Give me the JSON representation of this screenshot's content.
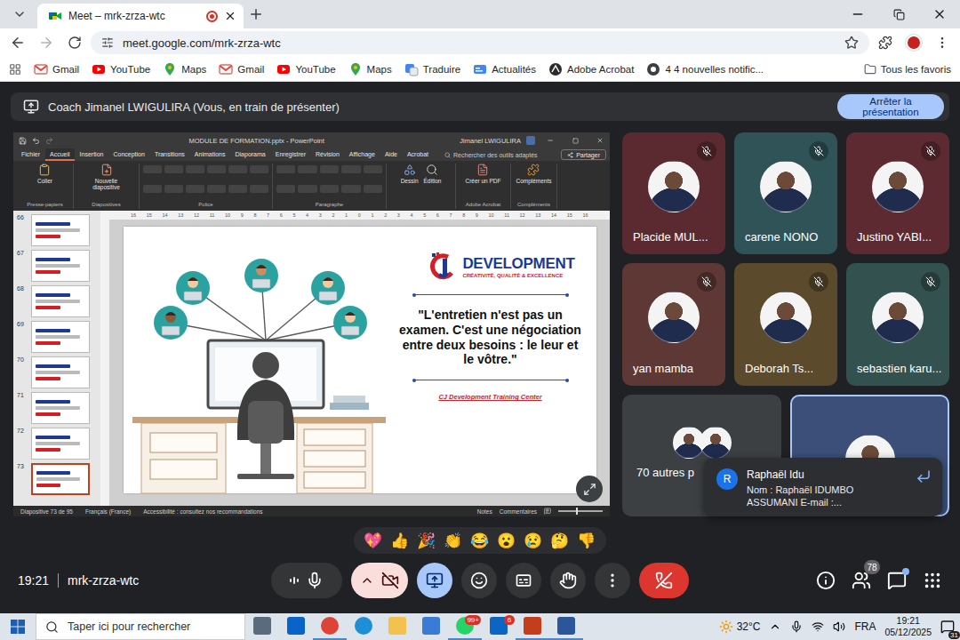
{
  "browser": {
    "tab": {
      "title": "Meet – mrk-zrza-wtc",
      "recording": true
    },
    "url": "meet.google.com/mrk-zrza-wtc",
    "bookmarked": false,
    "bookmarks": [
      {
        "label": "Gmail",
        "kind": "gmail"
      },
      {
        "label": "YouTube",
        "kind": "youtube"
      },
      {
        "label": "Maps",
        "kind": "maps"
      },
      {
        "label": "Gmail",
        "kind": "gmail"
      },
      {
        "label": "YouTube",
        "kind": "youtube"
      },
      {
        "label": "Maps",
        "kind": "maps"
      },
      {
        "label": "Traduire",
        "kind": "translate"
      },
      {
        "label": "Actualités",
        "kind": "news"
      },
      {
        "label": "Adobe Acrobat",
        "kind": "acrobat"
      },
      {
        "label": "4 4 nouvelles notific...",
        "kind": "notif"
      }
    ],
    "all_bookmarks": "Tous les favoris"
  },
  "meet": {
    "presenting_banner": "Coach Jimanel LWIGULIRA (Vous, en train de présenter)",
    "stop_button": "Arrêter la présentation",
    "participants": [
      {
        "name": "Placide MUL...",
        "muted": true,
        "color": "#5a2a30"
      },
      {
        "name": "carene NONO",
        "muted": true,
        "color": "#2f5357"
      },
      {
        "name": "Justino YABI...",
        "muted": true,
        "color": "#5e2a31"
      },
      {
        "name": "yan mamba",
        "muted": true,
        "color": "#5e3835"
      },
      {
        "name": "Deborah Ts...",
        "muted": true,
        "color": "#5b4a2b"
      },
      {
        "name": "sebastien karu...",
        "muted": true,
        "color": "#33524f"
      }
    ],
    "others": {
      "label": "70 autres p",
      "color": "#3c4043"
    },
    "self": {
      "color": "#3b4f78",
      "highlighted": true
    },
    "notification": {
      "avatar": "R",
      "name": "Raphaël Idu",
      "message": "Nom : Raphaël IDUMBO ASSUMANI E-mail :..."
    },
    "reactions": [
      "💖",
      "👍",
      "🎉",
      "👏",
      "😂",
      "😮",
      "😢",
      "🤔",
      "👎"
    ],
    "time": "19:21",
    "meeting_code": "mrk-zrza-wtc",
    "controls": [
      {
        "kind": "audio",
        "off": false
      },
      {
        "kind": "camera",
        "off": true
      },
      {
        "kind": "present",
        "active": true
      },
      {
        "kind": "reactions",
        "active": false
      },
      {
        "kind": "captions",
        "active": false
      },
      {
        "kind": "hand",
        "active": false
      },
      {
        "kind": "more",
        "active": false
      },
      {
        "kind": "leave"
      }
    ],
    "people_count": "78",
    "chat_unread": true
  },
  "powerpoint": {
    "title": "MODULE DE FORMATION.pptx - PowerPoint",
    "user": "Jimanel LWIGULIRA",
    "tabs": [
      {
        "label": "Fichier",
        "selected": false
      },
      {
        "label": "Accueil",
        "selected": true
      },
      {
        "label": "Insertion",
        "selected": false
      },
      {
        "label": "Conception",
        "selected": false
      },
      {
        "label": "Transitions",
        "selected": false
      },
      {
        "label": "Animations",
        "selected": false
      },
      {
        "label": "Diaporama",
        "selected": false
      },
      {
        "label": "Enregistrer",
        "selected": false
      },
      {
        "label": "Révision",
        "selected": false
      },
      {
        "label": "Affichage",
        "selected": false
      },
      {
        "label": "Aide",
        "selected": false
      },
      {
        "label": "Acrobat",
        "selected": false
      }
    ],
    "search": "Rechercher des outils adaptés",
    "share": "Partager",
    "ribbon_groups": [
      {
        "label": "Presse-papiers",
        "buttons": [
          {
            "label": "Coller",
            "kind": "paste"
          }
        ]
      },
      {
        "label": "Diapositives",
        "buttons": [
          {
            "label": "Nouvelle diapositive",
            "kind": "new-slide"
          }
        ]
      },
      {
        "label": "Police",
        "buttons": []
      },
      {
        "label": "Paragraphe",
        "buttons": []
      },
      {
        "label": "",
        "buttons": [
          {
            "label": "Dessin",
            "kind": "draw"
          },
          {
            "label": "Édition",
            "kind": "edit"
          }
        ]
      },
      {
        "label": "Adobe Acrobat",
        "buttons": [
          {
            "label": "Créer un PDF",
            "kind": "pdf"
          }
        ]
      },
      {
        "label": "Compléments",
        "buttons": [
          {
            "label": "Compléments",
            "kind": "addins"
          }
        ]
      }
    ],
    "ruler": [
      "16",
      "15",
      "14",
      "13",
      "12",
      "11",
      "10",
      "9",
      "8",
      "7",
      "6",
      "5",
      "4",
      "3",
      "2",
      "1",
      "0",
      "1",
      "2",
      "3",
      "4",
      "5",
      "6",
      "7",
      "8",
      "9",
      "10",
      "11",
      "12",
      "13",
      "14",
      "15",
      "16"
    ],
    "thumbnails": [
      {
        "number": "66",
        "selected": false
      },
      {
        "number": "67",
        "selected": false
      },
      {
        "number": "68",
        "selected": false
      },
      {
        "number": "69",
        "selected": false
      },
      {
        "number": "70",
        "selected": false
      },
      {
        "number": "71",
        "selected": false
      },
      {
        "number": "72",
        "selected": false
      },
      {
        "number": "73",
        "selected": true
      }
    ],
    "slide": {
      "brand": "DEVELOPMENT",
      "tagline": "CRÉATIVITÉ, QUALITÉ & EXCELLENCE",
      "quote": "\"L'entretien n'est pas un examen. C'est une négociation entre deux besoins : le leur et le vôtre.\"",
      "credit": "CJ Development Training Center"
    },
    "status": {
      "slide": "Diapositive 73 de 95",
      "language": "Français (France)",
      "accessibility": "Accessibilité : consultez nos recommandations",
      "notes": "Notes",
      "comments": "Commentaires"
    }
  },
  "taskbar": {
    "search": "Taper ici pour rechercher",
    "apps": [
      {
        "kind": "taskview",
        "open": false
      },
      {
        "kind": "outlook",
        "open": false
      },
      {
        "kind": "chrome",
        "open": true
      },
      {
        "kind": "edge",
        "open": false
      },
      {
        "kind": "explorer",
        "open": false
      },
      {
        "kind": "store",
        "open": false
      },
      {
        "kind": "whatsapp",
        "open": true,
        "badge": "99+"
      },
      {
        "kind": "linkedin",
        "open": false,
        "badge": "6"
      },
      {
        "kind": "powerpoint",
        "open": true
      },
      {
        "kind": "word",
        "open": true
      }
    ],
    "weather": "32°C",
    "language": "FRA",
    "time": "19:21",
    "date": "05/12/2025",
    "notifications": "31"
  }
}
